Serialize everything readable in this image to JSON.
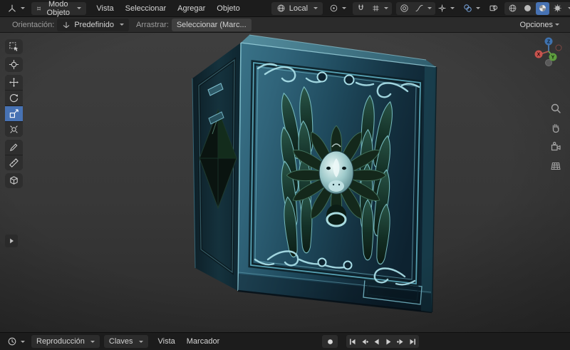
{
  "header": {
    "mode_label": "Modo Objeto",
    "menus": [
      "Vista",
      "Seleccionar",
      "Agregar",
      "Objeto"
    ],
    "transform_orientation": "Local",
    "shading_modes": [
      "wireframe",
      "solid",
      "material-preview",
      "rendered"
    ],
    "active_shading": "material-preview"
  },
  "tool_settings": {
    "orientation_label": "Orientación:",
    "orientation_value": "Predefinido",
    "drag_label": "Arrastrar:",
    "drag_value": "Seleccionar (Marc...",
    "options_label": "Opciones"
  },
  "toolbar": {
    "tools": [
      "select-box",
      "cursor",
      "move",
      "rotate",
      "scale",
      "transform",
      "annotate",
      "measure",
      "add-cube"
    ],
    "active_tool": "scale"
  },
  "viewport": {
    "gizmo_axes": {
      "x": "X",
      "y": "Y",
      "z": "Z"
    },
    "side_tools": [
      "zoom",
      "pan",
      "camera-view",
      "toggle-perspective"
    ]
  },
  "timeline": {
    "playback_menu": "Reproducción",
    "keys_menu": "Claves",
    "view_menu": "Vista",
    "marker_menu": "Marcador",
    "transport": [
      "record",
      "jump-to-start",
      "previous-keyframe",
      "play-reverse",
      "play",
      "next-keyframe",
      "jump-to-end"
    ]
  },
  "icons": {
    "editor_type": "3d-viewport-grid",
    "timeline_editor_type": "clock",
    "snap": "magnet",
    "record_glyph": "●",
    "play_glyph": "▶"
  },
  "colors": {
    "accent": "#4772b3",
    "axis_x": "#c8534e",
    "axis_y": "#5e9e3e",
    "axis_z": "#3f72ae",
    "box_metal": "#2e6577",
    "viewport_bg": "#3a3a3a"
  }
}
